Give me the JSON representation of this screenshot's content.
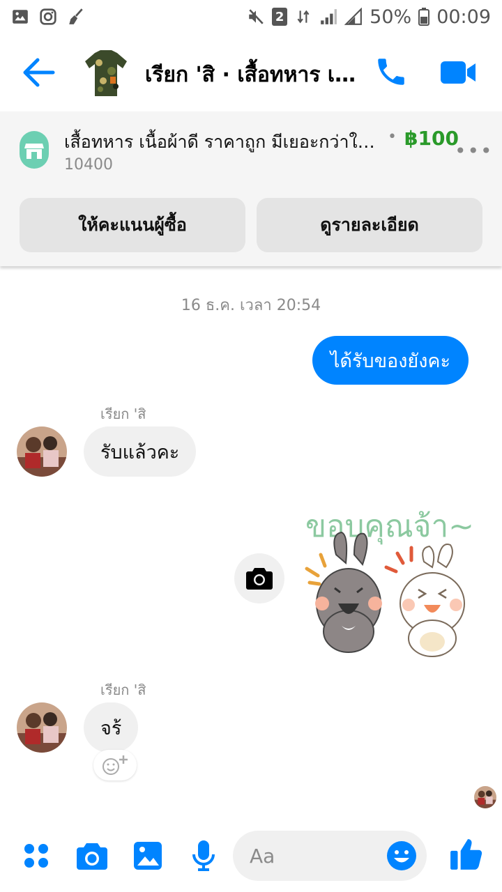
{
  "status_bar": {
    "sim_badge": "2",
    "battery": "50%",
    "time": "00:09",
    "left_icons": [
      "image-icon",
      "instagram-icon",
      "broom-icon"
    ],
    "right_icons": [
      "mute-icon",
      "sim-badge",
      "data-arrows-icon",
      "signal-icon",
      "battery-icon"
    ]
  },
  "header": {
    "title": "เรียก 'สิ · เสื้อทหาร เนื้อผ้าดี ราคาถูก",
    "icons": [
      "back-arrow-icon",
      "phone-icon",
      "video-call-icon"
    ]
  },
  "product": {
    "name": "เสื้อทหาร เนื้อผ้าดี ราคาถูก มีเยอะกว่าในร้าน",
    "price": "฿100",
    "postal_code": "10400",
    "rate_button": "ให้คะแนนผู้ซื้อ",
    "details_button": "ดูรายละเอียด"
  },
  "chat": {
    "timestamp": "16 ธ.ค. เวลา 20:54",
    "messages": [
      {
        "from": "me",
        "text": "ได้รับของยังคะ"
      },
      {
        "from": "them",
        "sender": "เรียก 'สิ",
        "text": "รับแล้วคะ"
      },
      {
        "from": "me",
        "sticker_text": "ขอบคุณจ้า~"
      },
      {
        "from": "them",
        "sender": "เรียก 'สิ",
        "text": "จร้"
      }
    ]
  },
  "composer": {
    "placeholder": "Aa",
    "icons": [
      "apps-icon",
      "camera-icon",
      "gallery-icon",
      "microphone-icon",
      "emoji-icon",
      "thumbs-up-icon"
    ]
  },
  "colors": {
    "accent": "#0084ff",
    "price": "#2a9a2a",
    "store": "#6ccfb2",
    "bubble_in": "#f0f0f0"
  }
}
